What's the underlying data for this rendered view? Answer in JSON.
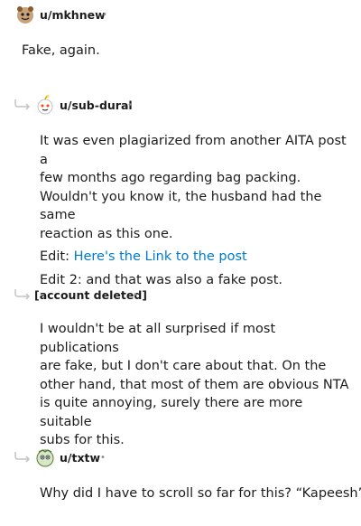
{
  "comments": [
    {
      "author": "u/mkhnew",
      "separator": "•",
      "avatar": "snoo-avatar-icon",
      "paragraphs": [
        "Fake, again."
      ]
    },
    {
      "author": "u/sub-dural",
      "separator": "•",
      "avatar": "snoo-avatar-icon",
      "lines": [
        "It was even plagiarized from another AITA post a",
        "few months ago regarding bag packing.",
        "Wouldn't you know it, the husband had the same",
        "reaction as this one."
      ],
      "edit_prefix": "Edit: ",
      "edit_link": "Here's the Link to the post",
      "edit2": "Edit 2: and that was also a fake post."
    },
    {
      "author": "[account deleted]",
      "separator": "•",
      "lines": [
        "I wouldn't be at all surprised if most publications",
        "are fake, but I don't care about that. On the",
        "other hand, that most of them are obvious NTA",
        "is quite annoying, surely there are more suitable",
        "subs for this."
      ]
    },
    {
      "author": "u/txtw",
      "separator": "•",
      "avatar": "snoo-avatar-icon",
      "lines": [
        "Why did I have to scroll so far for this? “Kapeesh”"
      ]
    }
  ],
  "icons": {
    "reply_thread": "reply-arrow-icon"
  },
  "colors": {
    "link": "#0079d3",
    "meta": "#878a8c",
    "text": "#1c1c1c"
  }
}
